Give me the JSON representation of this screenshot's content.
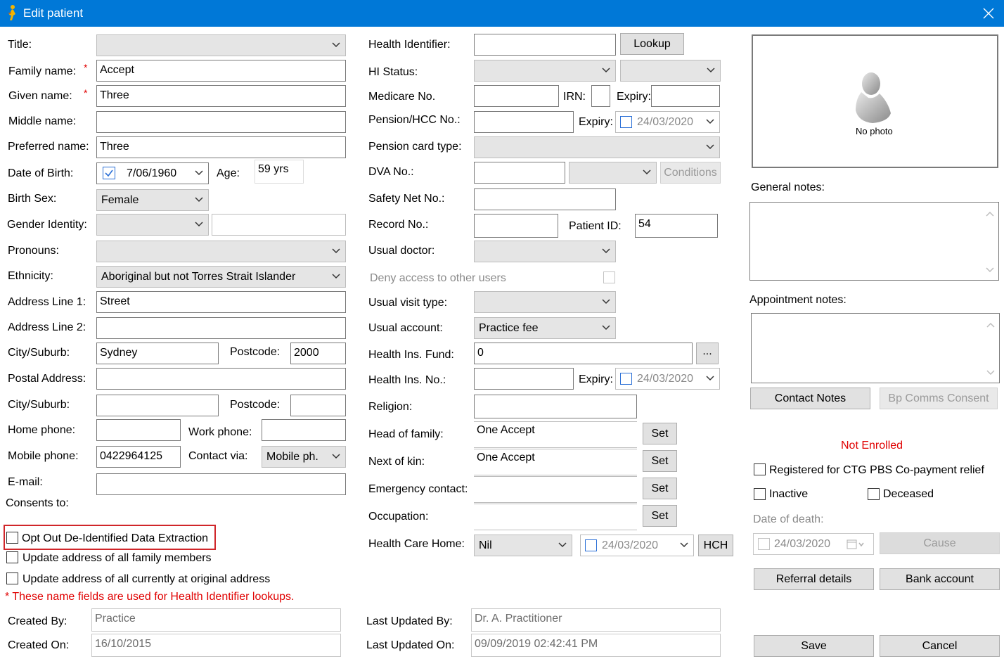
{
  "window": {
    "title": "Edit patient"
  },
  "left": {
    "title_label": "Title:",
    "family_name_label": "Family name:",
    "family_name_value": "Accept",
    "given_name_label": "Given name:",
    "given_name_value": "Three",
    "middle_name_label": "Middle name:",
    "preferred_name_label": "Preferred name:",
    "preferred_name_value": "Three",
    "dob_label": "Date of Birth:",
    "dob_value": "7/06/1960",
    "age_label": "Age:",
    "age_value": "59 yrs",
    "birth_sex_label": "Birth Sex:",
    "birth_sex_value": "Female",
    "gender_identity_label": "Gender Identity:",
    "pronouns_label": "Pronouns:",
    "ethnicity_label": "Ethnicity:",
    "ethnicity_value": "Aboriginal but not Torres Strait Islander",
    "address1_label": "Address Line 1:",
    "address1_value": "Street",
    "address2_label": "Address Line 2:",
    "city_label": "City/Suburb:",
    "city_value": "Sydney",
    "postcode_label": "Postcode:",
    "postcode_value": "2000",
    "postal_address_label": "Postal Address:",
    "postal_city_label": "City/Suburb:",
    "postal_postcode_label": "Postcode:",
    "home_phone_label": "Home phone:",
    "work_phone_label": "Work phone:",
    "mobile_phone_label": "Mobile phone:",
    "mobile_phone_value": "0422964125",
    "contact_via_label": "Contact via:",
    "contact_via_value": "Mobile ph.",
    "email_label": "E-mail:",
    "consents_label": "Consents to:",
    "opt_out_label": "Opt Out De-Identified Data Extraction",
    "update_family_label": "Update address of all family members",
    "update_original_label": "Update address of all currently at original address",
    "name_note": "* These name fields are used for Health Identifier lookups.",
    "created_by_label": "Created By:",
    "created_by_value": "Practice",
    "created_on_label": "Created On:",
    "created_on_value": "16/10/2015"
  },
  "middle": {
    "health_identifier_label": "Health Identifier:",
    "lookup_button": "Lookup",
    "hi_status_label": "HI Status:",
    "medicare_label": "Medicare No.",
    "irn_label": "IRN:",
    "expiry_label": "Expiry:",
    "pension_label": "Pension/HCC No.:",
    "pension_expiry_label": "Expiry:",
    "pension_expiry_value": "24/03/2020",
    "pension_type_label": "Pension card type:",
    "dva_label": "DVA No.:",
    "conditions_button": "Conditions",
    "safety_net_label": "Safety Net No.:",
    "record_no_label": "Record No.:",
    "patient_id_label": "Patient ID:",
    "patient_id_value": "54",
    "usual_doctor_label": "Usual doctor:",
    "deny_access_label": "Deny access to other users",
    "usual_visit_label": "Usual visit type:",
    "usual_account_label": "Usual account:",
    "usual_account_value": "Practice fee",
    "health_fund_label": "Health Ins. Fund:",
    "health_fund_value": "0",
    "ellipsis_button": "...",
    "health_no_label": "Health Ins. No.:",
    "health_expiry_label": "Expiry:",
    "health_expiry_value": "24/03/2020",
    "religion_label": "Religion:",
    "head_of_family_label": "Head of family:",
    "head_of_family_value": "One Accept",
    "next_of_kin_label": "Next of kin:",
    "next_of_kin_value": "One Accept",
    "emergency_label": "Emergency contact:",
    "occupation_label": "Occupation:",
    "set_button": "Set",
    "health_care_home_label": "Health Care Home:",
    "health_care_home_value": "Nil",
    "hch_date_value": "24/03/2020",
    "hch_button": "HCH",
    "last_updated_by_label": "Last Updated By:",
    "last_updated_by_value": "Dr. A. Practitioner",
    "last_updated_on_label": "Last Updated On:",
    "last_updated_on_value": "09/09/2019 02:42:41 PM"
  },
  "right": {
    "no_photo": "No photo",
    "general_notes_label": "General notes:",
    "appointment_notes_label": "Appointment notes:",
    "contact_notes_button": "Contact Notes",
    "bp_comms_button": "Bp Comms Consent",
    "not_enrolled": "Not Enrolled",
    "ctg_label": "Registered for CTG PBS Co-payment relief",
    "inactive_label": "Inactive",
    "deceased_label": "Deceased",
    "date_of_death_label": "Date of death:",
    "date_of_death_value": "24/03/2020",
    "cause_button": "Cause",
    "referral_button": "Referral details",
    "bank_button": "Bank account",
    "save_button": "Save",
    "cancel_button": "Cancel"
  },
  "colors": {
    "titlebar": "#0078d7",
    "required": "#e00000",
    "highlight": "#d0262a"
  }
}
